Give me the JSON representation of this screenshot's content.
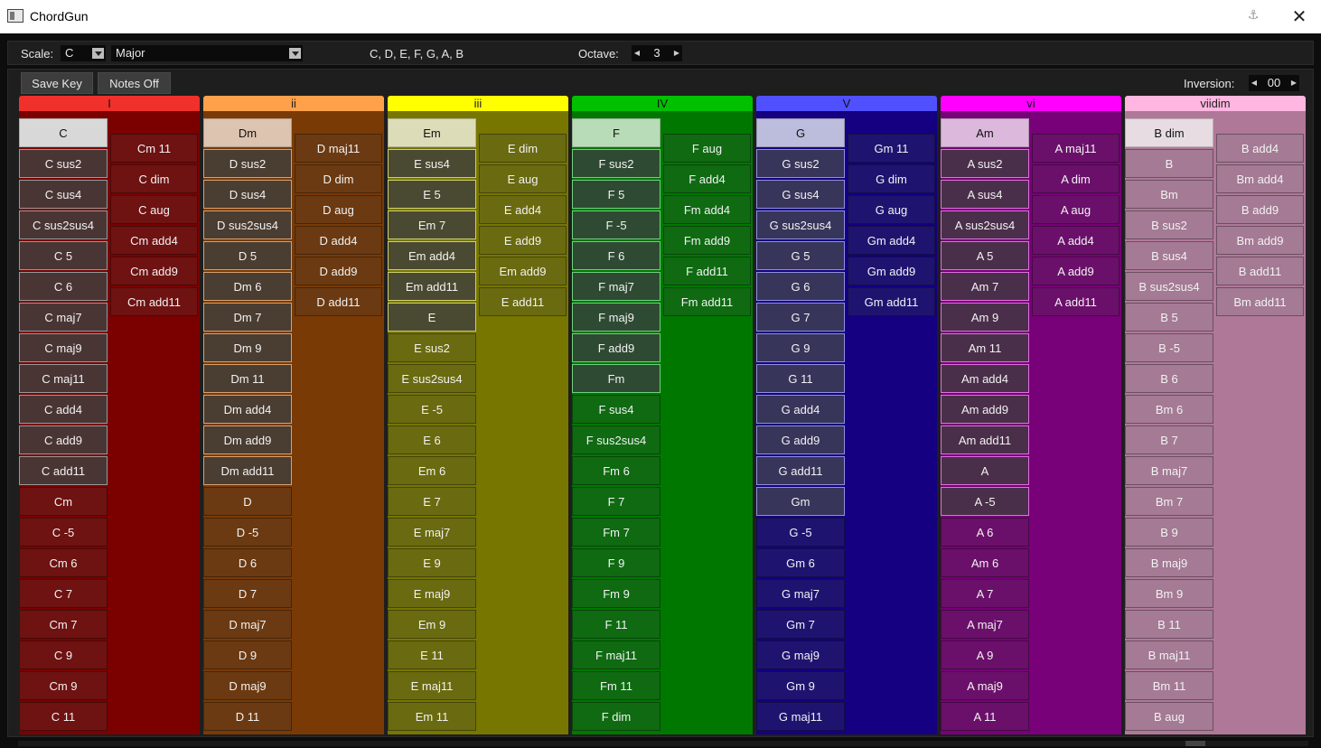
{
  "window": {
    "title": "ChordGun"
  },
  "scale": {
    "label": "Scale:",
    "tonic": "C",
    "type": "Major",
    "notes": "C, D, E, F, G, A, B",
    "octave_label": "Octave:",
    "octave": "3"
  },
  "toolbar": {
    "save_key": "Save Key",
    "notes_off": "Notes Off",
    "inversion_label": "Inversion:",
    "inversion": "00"
  },
  "columns": [
    {
      "degree": "I",
      "header_color": "#f0302a",
      "bg": "#7b0000",
      "chip": "#6e1212",
      "head_chip": "#d8d8d8",
      "sel_chip": "#4a3535",
      "sel_border": "#999999",
      "sel_count": 11,
      "left": [
        "C",
        "C sus2",
        "C sus4",
        "C sus2sus4",
        "C 5",
        "C 6",
        "C maj7",
        "C maj9",
        "C maj11",
        "C add4",
        "C add9",
        "C add11",
        "Cm",
        "C -5",
        "Cm 6",
        "C 7",
        "Cm 7",
        "C 9",
        "Cm 9",
        "C 11"
      ],
      "right": [
        "Cm 11",
        "C dim",
        "C aug",
        "Cm add4",
        "Cm add9",
        "Cm add11"
      ]
    },
    {
      "degree": "ii",
      "header_color": "#ffa04a",
      "bg": "#7a3a05",
      "chip": "#6b3a12",
      "head_chip": "#dcc4b0",
      "sel_chip": "#4a3d31",
      "sel_border": "#d9a070",
      "sel_count": 11,
      "left": [
        "Dm",
        "D sus2",
        "D sus4",
        "D sus2sus4",
        "D 5",
        "Dm 6",
        "Dm 7",
        "Dm 9",
        "Dm 11",
        "Dm add4",
        "Dm add9",
        "Dm add11",
        "D",
        "D -5",
        "D 6",
        "D 7",
        "D maj7",
        "D 9",
        "D maj9",
        "D 11"
      ],
      "right": [
        "D maj11",
        "D dim",
        "D aug",
        "D add4",
        "D add9",
        "D add11"
      ]
    },
    {
      "degree": "iii",
      "header_color": "#ffff00",
      "bg": "#767600",
      "chip": "#6a6a10",
      "head_chip": "#dcdcb8",
      "sel_chip": "#4a4a32",
      "sel_border": "#d0d070",
      "sel_count": 6,
      "left": [
        "Em",
        "E sus4",
        "E 5",
        "Em 7",
        "Em add4",
        "Em add11",
        "E",
        "E sus2",
        "E sus2sus4",
        "E -5",
        "E 6",
        "Em 6",
        "E 7",
        "E maj7",
        "E 9",
        "E maj9",
        "Em 9",
        "E 11",
        "E maj11",
        "Em 11"
      ],
      "right": [
        "E dim",
        "E aug",
        "E add4",
        "E add9",
        "Em add9",
        "E add11"
      ]
    },
    {
      "degree": "IV",
      "header_color": "#00c000",
      "bg": "#007800",
      "chip": "#0f6a12",
      "head_chip": "#b8dcb8",
      "sel_chip": "#2f4a33",
      "sel_border": "#70d080",
      "sel_count": 8,
      "left": [
        "F",
        "F sus2",
        "F 5",
        "F -5",
        "F 6",
        "F maj7",
        "F maj9",
        "F add9",
        "Fm",
        "F sus4",
        "F sus2sus4",
        "Fm 6",
        "F 7",
        "Fm 7",
        "F 9",
        "Fm 9",
        "F 11",
        "F maj11",
        "Fm 11",
        "F dim"
      ],
      "right": [
        "F aug",
        "F add4",
        "Fm add4",
        "Fm add9",
        "F add11",
        "Fm add11"
      ]
    },
    {
      "degree": "V",
      "header_color": "#5050ff",
      "bg": "#140080",
      "chip": "#1e1470",
      "head_chip": "#bcbcdc",
      "sel_chip": "#37355a",
      "sel_border": "#9090e0",
      "sel_count": 12,
      "left": [
        "G",
        "G sus2",
        "G sus4",
        "G sus2sus4",
        "G 5",
        "G 6",
        "G 7",
        "G 9",
        "G 11",
        "G add4",
        "G add9",
        "G add11",
        "Gm",
        "G -5",
        "Gm 6",
        "G maj7",
        "Gm 7",
        "G maj9",
        "Gm 9",
        "G maj11"
      ],
      "right": [
        "Gm 11",
        "G dim",
        "G aug",
        "Gm add4",
        "Gm add9",
        "Gm add11"
      ]
    },
    {
      "degree": "vi",
      "header_color": "#ff00ff",
      "bg": "#780078",
      "chip": "#6a106a",
      "head_chip": "#dcb8dc",
      "sel_chip": "#4a2f4a",
      "sel_border": "#e070e0",
      "sel_count": 12,
      "left": [
        "Am",
        "A sus2",
        "A sus4",
        "A sus2sus4",
        "A 5",
        "Am 7",
        "Am 9",
        "Am 11",
        "Am add4",
        "Am add9",
        "Am add11",
        "A",
        "A -5",
        "A 6",
        "Am 6",
        "A 7",
        "A maj7",
        "A 9",
        "A maj9",
        "A 11"
      ],
      "right": [
        "A maj11",
        "A dim",
        "A aug",
        "A add4",
        "A add9",
        "A add11"
      ]
    },
    {
      "degree": "viidim",
      "header_color": "#ffb6e0",
      "bg": "#b07898",
      "chip": "#a47a94",
      "head_chip": "#e6dce2",
      "sel_chip": "#a47a94",
      "sel_border": "#5a3a4e",
      "sel_count": 0,
      "left": [
        "B dim",
        "B",
        "Bm",
        "B sus2",
        "B sus4",
        "B sus2sus4",
        "B 5",
        "B -5",
        "B 6",
        "Bm 6",
        "B 7",
        "B maj7",
        "Bm 7",
        "B 9",
        "B maj9",
        "Bm 9",
        "B 11",
        "B maj11",
        "Bm 11",
        "B aug"
      ],
      "right": [
        "B add4",
        "Bm add4",
        "B add9",
        "Bm add9",
        "B add11",
        "Bm add11"
      ]
    }
  ]
}
